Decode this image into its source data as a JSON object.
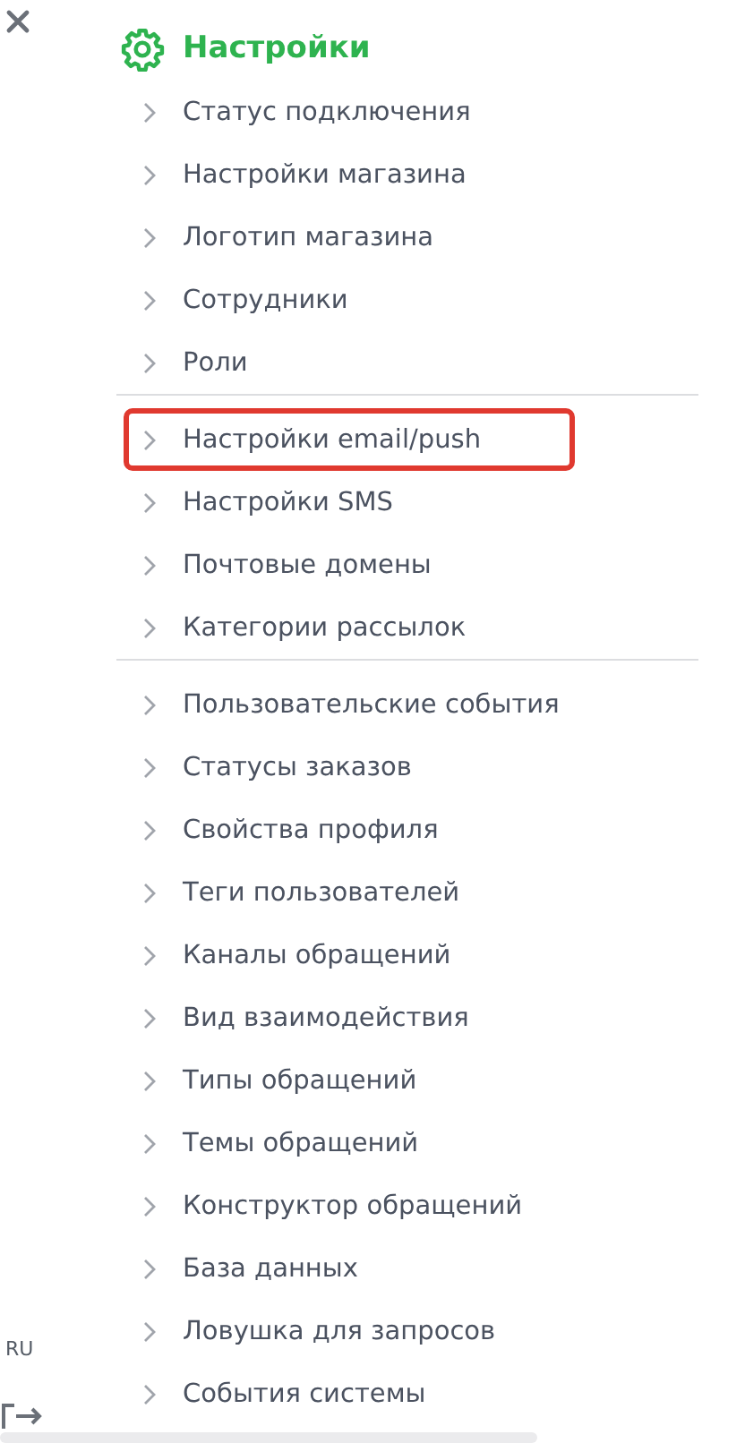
{
  "sidebar": {
    "language": "RU"
  },
  "menu": {
    "title": "Настройки",
    "groups": [
      {
        "items": [
          {
            "label": "Статус подключения",
            "highlighted": false
          },
          {
            "label": "Настройки магазина",
            "highlighted": false
          },
          {
            "label": "Логотип магазина",
            "highlighted": false
          },
          {
            "label": "Сотрудники",
            "highlighted": false
          },
          {
            "label": "Роли",
            "highlighted": false
          }
        ]
      },
      {
        "items": [
          {
            "label": "Настройки email/push",
            "highlighted": true
          },
          {
            "label": "Настройки SMS",
            "highlighted": false
          },
          {
            "label": "Почтовые домены",
            "highlighted": false
          },
          {
            "label": "Категории рассылок",
            "highlighted": false
          }
        ]
      },
      {
        "items": [
          {
            "label": "Пользовательские события",
            "highlighted": false
          },
          {
            "label": "Статусы заказов",
            "highlighted": false
          },
          {
            "label": "Свойства профиля",
            "highlighted": false
          },
          {
            "label": "Теги пользователей",
            "highlighted": false
          },
          {
            "label": "Каналы обращений",
            "highlighted": false
          },
          {
            "label": "Вид взаимодействия",
            "highlighted": false
          },
          {
            "label": "Типы обращений",
            "highlighted": false
          },
          {
            "label": "Темы обращений",
            "highlighted": false
          },
          {
            "label": "Конструктор обращений",
            "highlighted": false
          },
          {
            "label": "База данных",
            "highlighted": false
          },
          {
            "label": "Ловушка для запросов",
            "highlighted": false
          },
          {
            "label": "События системы",
            "highlighted": false
          }
        ]
      }
    ]
  }
}
